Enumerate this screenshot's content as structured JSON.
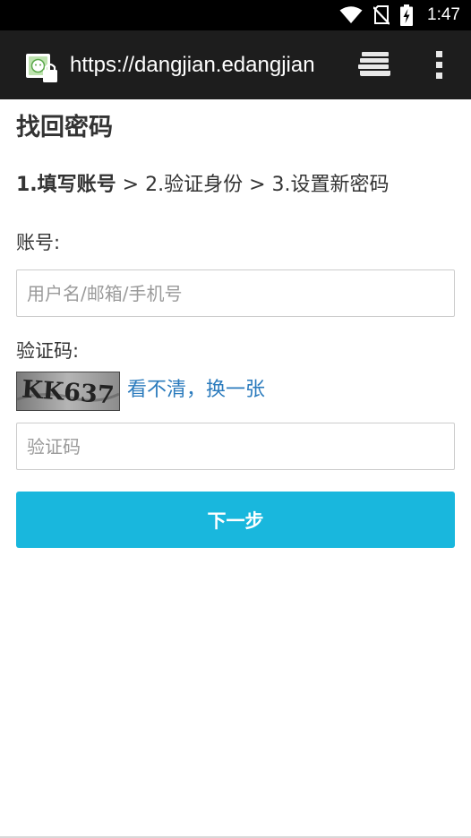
{
  "status_bar": {
    "time": "1:47",
    "icons": [
      "wifi-icon",
      "no-sim-icon",
      "battery-charging-icon"
    ]
  },
  "browser": {
    "url": "https://dangjian.edangjian",
    "icons": [
      "site-lock-icon",
      "tabs-icon",
      "overflow-menu-icon"
    ]
  },
  "page": {
    "title": "找回密码",
    "steps": {
      "step1": "1.填写账号",
      "separator1": " > ",
      "step2": "2.验证身份",
      "separator2": " > ",
      "step3": "3.设置新密码"
    },
    "account_label": "账号:",
    "account_placeholder": "用户名/邮箱/手机号",
    "captcha_label": "验证码:",
    "captcha_text": "KK637",
    "captcha_refresh": "看不清，换一张",
    "captcha_placeholder": "验证码",
    "next_button": "下一步"
  },
  "colors": {
    "primary_button": "#19b7dd",
    "link": "#2b7bbd",
    "browser_bar": "#1d1d1d",
    "status_bar": "#000000"
  }
}
